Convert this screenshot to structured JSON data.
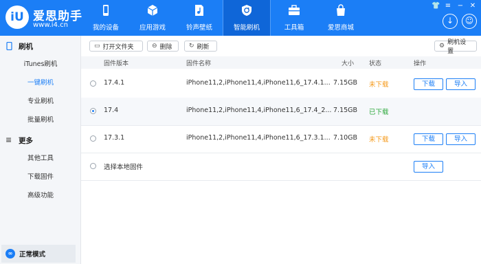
{
  "header": {
    "logo_glyph": "iU",
    "brand": "爱思助手",
    "url": "www.i4.cn",
    "nav": [
      {
        "label": "我的设备",
        "icon": "phone-icon"
      },
      {
        "label": "应用游戏",
        "icon": "cube-icon"
      },
      {
        "label": "铃声壁纸",
        "icon": "music-file-icon"
      },
      {
        "label": "智能刷机",
        "icon": "refresh-shield-icon",
        "active": true
      },
      {
        "label": "工具箱",
        "icon": "toolbox-icon"
      },
      {
        "label": "爱思商城",
        "icon": "shopping-bag-icon"
      }
    ],
    "accent": "#1b7ef6"
  },
  "sidebar": {
    "section1": "刷机",
    "items1": [
      "iTunes刷机",
      "一键刷机",
      "专业刷机",
      "批量刷机"
    ],
    "section2": "更多",
    "items2": [
      "其他工具",
      "下载固件",
      "高级功能"
    ],
    "mode": "正常模式"
  },
  "toolbar": {
    "open_folder": "打开文件夹",
    "delete": "删除",
    "refresh": "刷新",
    "settings": "刷机设置"
  },
  "table": {
    "headers": {
      "version": "固件版本",
      "name": "固件名称",
      "size": "大小",
      "status": "状态",
      "action": "操作"
    },
    "rows": [
      {
        "version": "17.4.1",
        "name": "iPhone11,2,iPhone11,4,iPhone11,6_17.4.1...",
        "size": "7.15GB",
        "status": "未下载",
        "selected": false,
        "download": "下载",
        "import": "导入"
      },
      {
        "version": "17.4",
        "name": "iPhone11,2,iPhone11,4,iPhone11,6_17.4_2...",
        "size": "7.15GB",
        "status": "已下载",
        "selected": true
      },
      {
        "version": "17.3.1",
        "name": "iPhone11,2,iPhone11,4,iPhone11,6_17.3.1...",
        "size": "7.10GB",
        "status": "未下载",
        "selected": false,
        "download": "下载",
        "import": "导入"
      }
    ],
    "local": {
      "label": "选择本地固件",
      "import": "导入"
    }
  }
}
